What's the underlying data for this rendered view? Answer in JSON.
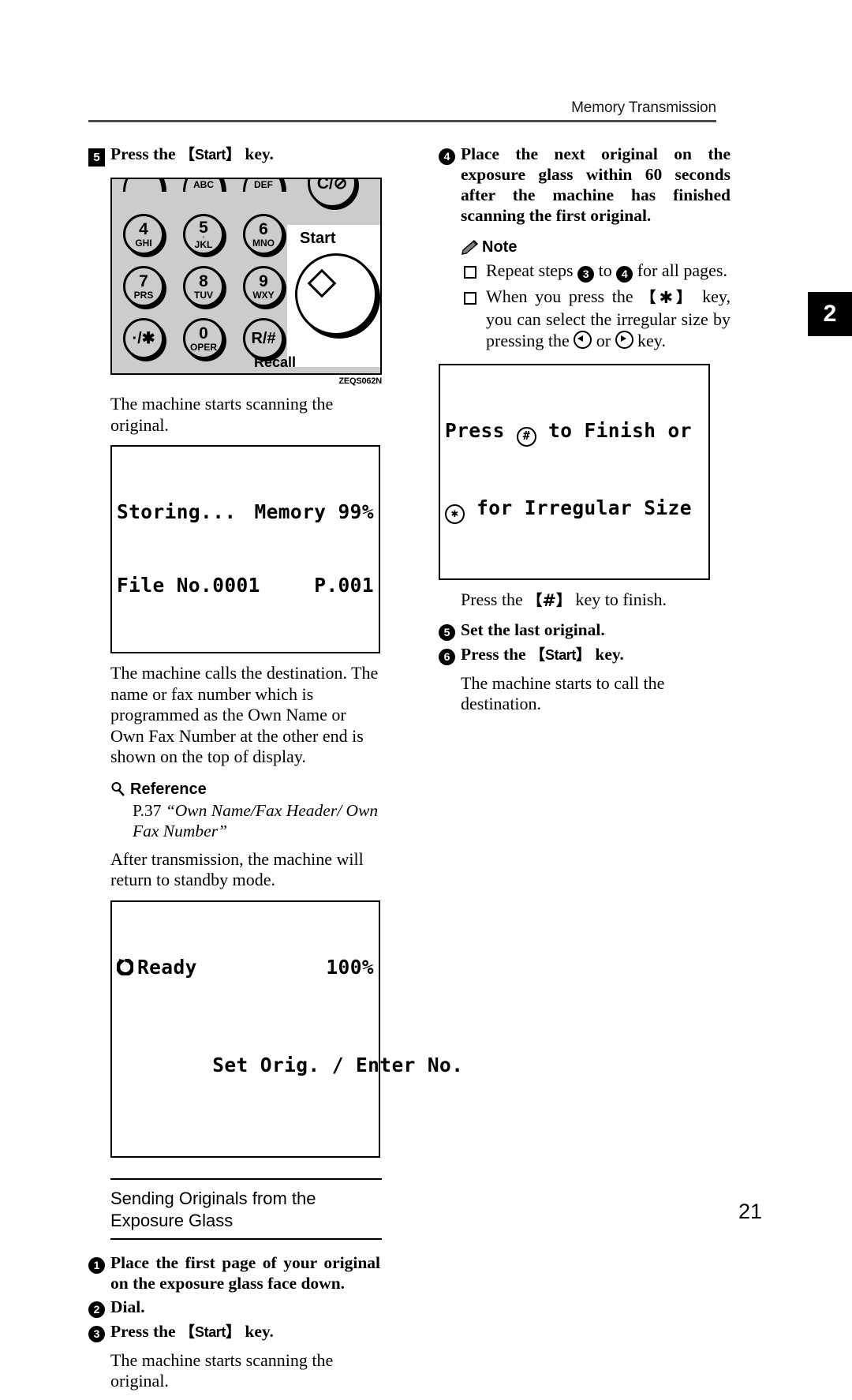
{
  "page": {
    "header_title": "Memory Transmission",
    "folio": "21",
    "thumb_tab": "2"
  },
  "left_column": {
    "step5": {
      "number": "5",
      "text_before": "Press the ",
      "keycap": "Start",
      "text_after": " key."
    },
    "figure": {
      "caption": "ZEQS062N",
      "start_label": "Start",
      "recall_label": "Recall",
      "clear_key": "C/⊘",
      "keys": [
        {
          "digit": "",
          "letters": "",
          "pos": "r0c0"
        },
        {
          "digit": "",
          "letters": "ABC",
          "pos": "r0c1"
        },
        {
          "digit": "",
          "letters": "DEF",
          "pos": "r0c2"
        },
        {
          "digit": "4",
          "letters": "GHI",
          "pos": "r1c0"
        },
        {
          "digit": "5",
          "letters": "JKL",
          "pos": "r1c1"
        },
        {
          "digit": "6",
          "letters": "MNO",
          "pos": "r1c2"
        },
        {
          "digit": "7",
          "letters": "PRS",
          "pos": "r2c0"
        },
        {
          "digit": "8",
          "letters": "TUV",
          "pos": "r2c1"
        },
        {
          "digit": "9",
          "letters": "WXY",
          "pos": "r2c2"
        },
        {
          "digit": "·/✱",
          "letters": "",
          "pos": "r3c0"
        },
        {
          "digit": "0",
          "letters": "OPER",
          "pos": "r3c1"
        },
        {
          "digit": "R/#",
          "letters": "",
          "pos": "r3c2"
        }
      ]
    },
    "para_scanning": "The machine starts scanning the original.",
    "lcd_storing": {
      "line1_left": "Storing...",
      "line1_right": "Memory 99%",
      "line2_left": "File No.0001",
      "line2_right": "P.001"
    },
    "para_calls": "The machine calls the destination. The name or fax number which is programmed as the Own Name or Own Fax Number at the other end is shown on the top of display.",
    "reference": {
      "heading": "Reference",
      "page_ref": "P.37 ",
      "title": "“Own Name/Fax Header/ Own Fax Number”"
    },
    "para_after": "After transmission, the machine will return to standby mode.",
    "lcd_ready": {
      "line1_left": "Ready",
      "line1_right": "100%",
      "line2": "Set Orig. / Enter No."
    },
    "section": {
      "title": "Sending Originals from the Exposure Glass"
    },
    "step1": {
      "number": "1",
      "text": "Place the first page of your original on the exposure glass face down."
    },
    "step2": {
      "number": "2",
      "text": "Dial."
    },
    "step3": {
      "number": "3",
      "text_before": "Press the ",
      "keycap": "Start",
      "text_after": " key."
    },
    "para_scanning2": "The machine starts scanning the original."
  },
  "right_column": {
    "step4": {
      "number": "4",
      "text": "Place the next original on the exposure glass within 60 seconds after the machine has finished scanning the first original."
    },
    "note": {
      "heading": "Note",
      "items": [
        {
          "before": "Repeat steps ",
          "badge_a": "3",
          "middle": " to ",
          "badge_b": "4",
          "after": " for all pages."
        },
        {
          "before": "When you press the ",
          "star": "✱",
          "after": " key, you can select the irregular size by pressing the ",
          "arrow_left": "◁",
          "between": " or ",
          "arrow_right": "▷",
          "tail": " key."
        }
      ]
    },
    "lcd_finish": {
      "line1_before": "Press ",
      "line1_key": "#",
      "line1_after": " to Finish or",
      "line2_key": "✱",
      "line2_after": " for Irregular Size"
    },
    "para_press_hash": {
      "before": "Press the ",
      "keycap": "#",
      "after": " key to finish."
    },
    "step5": {
      "number": "5",
      "text": "Set the last original."
    },
    "step6": {
      "number": "6",
      "text_before": "Press the ",
      "keycap": "Start",
      "text_after": " key."
    },
    "para_calls": "The machine starts to call the destination."
  }
}
